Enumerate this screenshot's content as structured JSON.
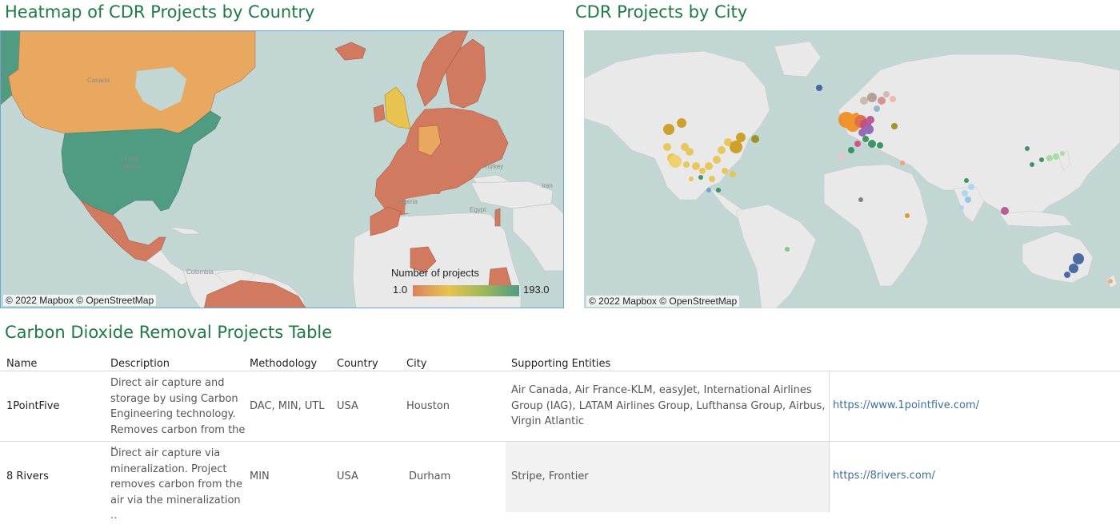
{
  "heatmap": {
    "title": "Heatmap of CDR Projects by Country",
    "credit": "© 2022 Mapbox  © OpenStreetMap",
    "legend": {
      "title": "Number of projects",
      "min": "1.0",
      "max": "193.0"
    },
    "place_labels": [
      "Canada",
      "United States",
      "Turkey",
      "Iran",
      "Algeria",
      "Egypt",
      "Colombia"
    ],
    "colors": {
      "high": "#4f9c83",
      "mid_high": "#e8a85f",
      "low": "#d27a60",
      "uk": "#e8c34f",
      "land": "#e9e9e9",
      "water": "#c2d6d4"
    }
  },
  "city_map": {
    "title": "CDR Projects by City",
    "credit": "© 2022 Mapbox  © OpenStreetMap"
  },
  "table": {
    "title": "Carbon Dioxide Removal Projects Table",
    "headers": {
      "name": "Name",
      "description": "Description",
      "methodology": "Methodology",
      "country": "Country",
      "city": "City",
      "supporting": "Supporting Entities"
    },
    "rows": [
      {
        "name": "1PointFive",
        "description": [
          "Direct air capture and",
          "storage by using Carbon",
          "Engineering technology.",
          "Removes carbon from the .."
        ],
        "methodology": "DAC, MIN, UTL",
        "country": "USA",
        "city": "Houston",
        "supporting": [
          "Air Canada, Air France-KLM, easyJet, International Airlines",
          "Group (IAG), LATAM Airlines Group, Lufthansa Group, Airbus,",
          "Virgin Atlantic"
        ],
        "url": "https://www.1pointfive.com/"
      },
      {
        "name": "8 Rivers",
        "description": [
          "Direct air capture via",
          "mineralization. Project",
          "removes carbon from the",
          "air via the mineralization .."
        ],
        "methodology": "MIN",
        "country": "USA",
        "city": "Durham",
        "supporting": [
          "Stripe, Frontier"
        ],
        "url": "https://8rivers.com/"
      }
    ]
  }
}
